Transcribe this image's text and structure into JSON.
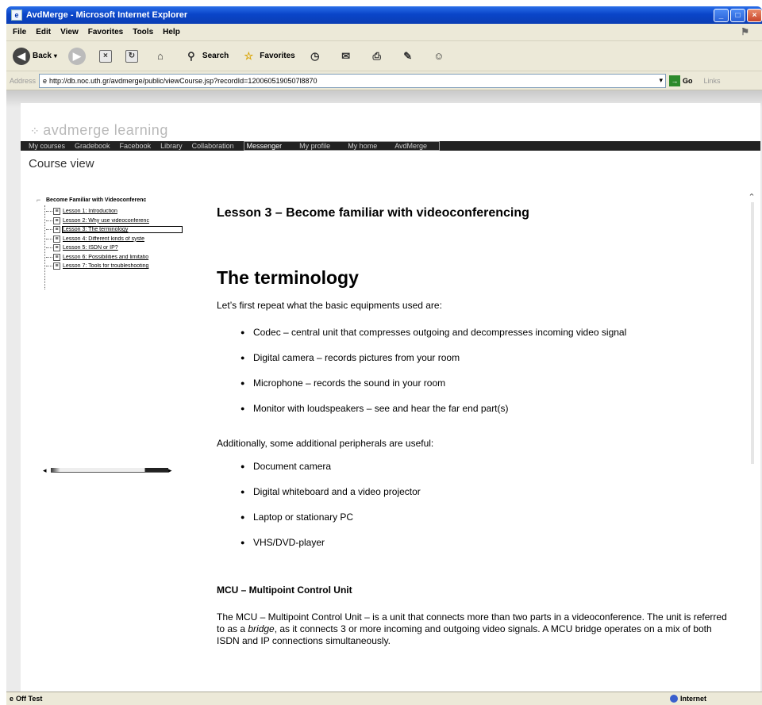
{
  "window": {
    "title": "AvdMerge - Microsoft Internet Explorer"
  },
  "menubar": [
    "File",
    "Edit",
    "View",
    "Favorites",
    "Tools",
    "Help"
  ],
  "toolbar": {
    "back": "Back",
    "search": "Search",
    "favorites": "Favorites"
  },
  "addressbar": {
    "label": "Address",
    "url": "http://db.noc.uth.gr/avdmerge/public/viewCourse.jsp?recordId=1200605190507l8870",
    "go": "Go",
    "links": "Links"
  },
  "site": {
    "brand": "avdmerge learning",
    "nav": [
      "My courses",
      "Gradebook",
      "Facebook",
      "Library",
      "Collaboration",
      "Messenger",
      "My profile",
      "My home",
      "AvdMerge"
    ],
    "page_heading": "Course view"
  },
  "tree": {
    "root": "Become Familiar with Videoconferenc",
    "items": [
      "Lesson 1: Introduction",
      "Lesson 2: Why use videoconferenc",
      "Lesson 3: The terminology",
      "Lesson 4: Different kinds of syste",
      "Lesson 5: ISDN or IP?",
      "Lesson 6: Possibilities and limitatio",
      "Lesson 7: Tools for troubleshooting"
    ],
    "selected_index": 2
  },
  "content": {
    "lesson_title": "Lesson 3 – Become familiar with videoconferencing",
    "section_title": "The terminology",
    "intro": "Let’s first repeat what the basic equipments used are:",
    "equipments": [
      "Codec – central unit that compresses outgoing and decompresses incoming video signal",
      "Digital camera – records pictures from your room",
      "Microphone – records the sound in your room",
      "Monitor with loudspeakers – see and hear the far end part(s)"
    ],
    "additional_intro": "Additionally, some additional peripherals are useful:",
    "peripherals": [
      "Document camera",
      "Digital whiteboard and a video projector",
      "Laptop or stationary PC",
      "VHS/DVD-player"
    ],
    "mcu_heading": "MCU – Multipoint Control Unit",
    "mcu_part1": "The MCU – Multipoint Control Unit – is a unit that connects more than two parts in a videoconference. The unit is referred to as a ",
    "mcu_italic": "bridge",
    "mcu_part2": ", as it connects 3 or more incoming and outgoing video signals.  A MCU bridge operates on a mix of both ISDN and IP connections simultaneously."
  },
  "statusbar": {
    "left": "Off Test",
    "zone": "Internet"
  }
}
